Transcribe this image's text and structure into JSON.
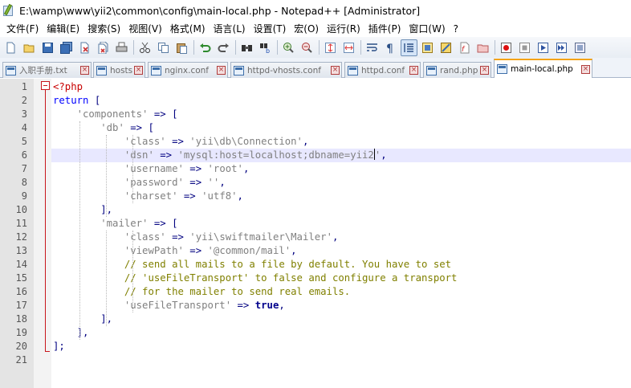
{
  "window": {
    "title": "E:\\wamp\\www\\yii2\\common\\config\\main-local.php - Notepad++ [Administrator]"
  },
  "menu": [
    "文件(F)",
    "编辑(E)",
    "搜索(S)",
    "视图(V)",
    "格式(M)",
    "语言(L)",
    "设置(T)",
    "宏(O)",
    "运行(R)",
    "插件(P)",
    "窗口(W)",
    "?"
  ],
  "toolbar": [
    {
      "icon": "new-file-icon"
    },
    {
      "icon": "open-file-icon"
    },
    {
      "icon": "save-icon"
    },
    {
      "icon": "save-all-icon"
    },
    {
      "icon": "close-icon"
    },
    {
      "icon": "close-all-icon"
    },
    {
      "icon": "print-icon"
    },
    {
      "sep": true
    },
    {
      "icon": "cut-icon"
    },
    {
      "icon": "copy-icon"
    },
    {
      "icon": "paste-icon"
    },
    {
      "sep": true
    },
    {
      "icon": "undo-icon"
    },
    {
      "icon": "redo-icon"
    },
    {
      "sep": true
    },
    {
      "icon": "find-icon"
    },
    {
      "icon": "replace-icon"
    },
    {
      "sep": true
    },
    {
      "icon": "zoom-in-icon"
    },
    {
      "icon": "zoom-out-icon"
    },
    {
      "sep": true
    },
    {
      "icon": "sync-vertical-icon"
    },
    {
      "icon": "sync-horizontal-icon"
    },
    {
      "sep": true
    },
    {
      "icon": "word-wrap-icon"
    },
    {
      "icon": "show-all-chars-icon"
    },
    {
      "icon": "indent-guide-icon",
      "active": true
    },
    {
      "icon": "user-language-icon"
    },
    {
      "icon": "doc-map-icon"
    },
    {
      "icon": "function-list-icon"
    },
    {
      "icon": "folder-workspace-icon"
    },
    {
      "sep": true
    },
    {
      "icon": "record-macro-icon"
    },
    {
      "icon": "stop-record-icon"
    },
    {
      "icon": "play-macro-icon"
    },
    {
      "icon": "run-macro-multiple-icon"
    },
    {
      "icon": "save-macro-icon"
    }
  ],
  "tabs": [
    {
      "label": "入职手册.txt",
      "active": false
    },
    {
      "label": "hosts",
      "active": false
    },
    {
      "label": "nginx.conf",
      "active": false
    },
    {
      "label": "httpd-vhosts.conf",
      "active": false
    },
    {
      "label": "httpd.conf",
      "active": false
    },
    {
      "label": "rand.php",
      "active": false
    },
    {
      "label": "main-local.php",
      "active": true
    }
  ],
  "editor": {
    "current_line": 6,
    "lines": [
      {
        "n": "1",
        "tokens": [
          [
            "php",
            "<?php"
          ]
        ]
      },
      {
        "n": "2",
        "tokens": [
          [
            "kw",
            "return"
          ],
          [
            "txt",
            " "
          ],
          [
            "op",
            "["
          ]
        ]
      },
      {
        "n": "3",
        "tokens": [
          [
            "txt",
            "    "
          ],
          [
            "str",
            "'components'"
          ],
          [
            "txt",
            " "
          ],
          [
            "op",
            "=>"
          ],
          [
            "txt",
            " "
          ],
          [
            "op",
            "["
          ]
        ]
      },
      {
        "n": "4",
        "tokens": [
          [
            "txt",
            "        "
          ],
          [
            "str",
            "'db'"
          ],
          [
            "txt",
            " "
          ],
          [
            "op",
            "=>"
          ],
          [
            "txt",
            " "
          ],
          [
            "op",
            "["
          ]
        ]
      },
      {
        "n": "5",
        "tokens": [
          [
            "txt",
            "            "
          ],
          [
            "str",
            "'class'"
          ],
          [
            "txt",
            " "
          ],
          [
            "op",
            "=>"
          ],
          [
            "txt",
            " "
          ],
          [
            "str",
            "'yii\\db\\Connection'"
          ],
          [
            "op",
            ","
          ]
        ]
      },
      {
        "n": "6",
        "tokens": [
          [
            "txt",
            "            "
          ],
          [
            "str",
            "'dsn'"
          ],
          [
            "txt",
            " "
          ],
          [
            "op",
            "=>"
          ],
          [
            "txt",
            " "
          ],
          [
            "str",
            "'mysql:host=localhost;dbname=yii2"
          ],
          [
            "caret",
            ""
          ],
          [
            "str",
            "'"
          ],
          [
            "op",
            ","
          ]
        ]
      },
      {
        "n": "7",
        "tokens": [
          [
            "txt",
            "            "
          ],
          [
            "str",
            "'username'"
          ],
          [
            "txt",
            " "
          ],
          [
            "op",
            "=>"
          ],
          [
            "txt",
            " "
          ],
          [
            "str",
            "'root'"
          ],
          [
            "op",
            ","
          ]
        ]
      },
      {
        "n": "8",
        "tokens": [
          [
            "txt",
            "            "
          ],
          [
            "str",
            "'password'"
          ],
          [
            "txt",
            " "
          ],
          [
            "op",
            "=>"
          ],
          [
            "txt",
            " "
          ],
          [
            "str",
            "''"
          ],
          [
            "op",
            ","
          ]
        ]
      },
      {
        "n": "9",
        "tokens": [
          [
            "txt",
            "            "
          ],
          [
            "str",
            "'charset'"
          ],
          [
            "txt",
            " "
          ],
          [
            "op",
            "=>"
          ],
          [
            "txt",
            " "
          ],
          [
            "str",
            "'utf8'"
          ],
          [
            "op",
            ","
          ]
        ]
      },
      {
        "n": "10",
        "tokens": [
          [
            "txt",
            "        "
          ],
          [
            "op",
            "],"
          ]
        ]
      },
      {
        "n": "11",
        "tokens": [
          [
            "txt",
            "        "
          ],
          [
            "str",
            "'mailer'"
          ],
          [
            "txt",
            " "
          ],
          [
            "op",
            "=>"
          ],
          [
            "txt",
            " "
          ],
          [
            "op",
            "["
          ]
        ]
      },
      {
        "n": "12",
        "tokens": [
          [
            "txt",
            "            "
          ],
          [
            "str",
            "'class'"
          ],
          [
            "txt",
            " "
          ],
          [
            "op",
            "=>"
          ],
          [
            "txt",
            " "
          ],
          [
            "str",
            "'yii\\swiftmailer\\Mailer'"
          ],
          [
            "op",
            ","
          ]
        ]
      },
      {
        "n": "13",
        "tokens": [
          [
            "txt",
            "            "
          ],
          [
            "str",
            "'viewPath'"
          ],
          [
            "txt",
            " "
          ],
          [
            "op",
            "=>"
          ],
          [
            "txt",
            " "
          ],
          [
            "str",
            "'@common/mail'"
          ],
          [
            "op",
            ","
          ]
        ]
      },
      {
        "n": "14",
        "tokens": [
          [
            "txt",
            "            "
          ],
          [
            "cmt",
            "// send all mails to a file by default. You have to set"
          ]
        ]
      },
      {
        "n": "15",
        "tokens": [
          [
            "txt",
            "            "
          ],
          [
            "cmt",
            "// 'useFileTransport' to false and configure a transport"
          ]
        ]
      },
      {
        "n": "16",
        "tokens": [
          [
            "txt",
            "            "
          ],
          [
            "cmt",
            "// for the mailer to send real emails."
          ]
        ]
      },
      {
        "n": "17",
        "tokens": [
          [
            "txt",
            "            "
          ],
          [
            "str",
            "'useFileTransport'"
          ],
          [
            "txt",
            " "
          ],
          [
            "op",
            "=>"
          ],
          [
            "txt",
            " "
          ],
          [
            "bool",
            "true"
          ],
          [
            "op",
            ","
          ]
        ]
      },
      {
        "n": "18",
        "tokens": [
          [
            "txt",
            "        "
          ],
          [
            "op",
            "],"
          ]
        ]
      },
      {
        "n": "19",
        "tokens": [
          [
            "txt",
            "    "
          ],
          [
            "op",
            "],"
          ]
        ]
      },
      {
        "n": "20",
        "tokens": [
          [
            "op",
            "];"
          ]
        ]
      },
      {
        "n": "21",
        "tokens": []
      }
    ]
  }
}
